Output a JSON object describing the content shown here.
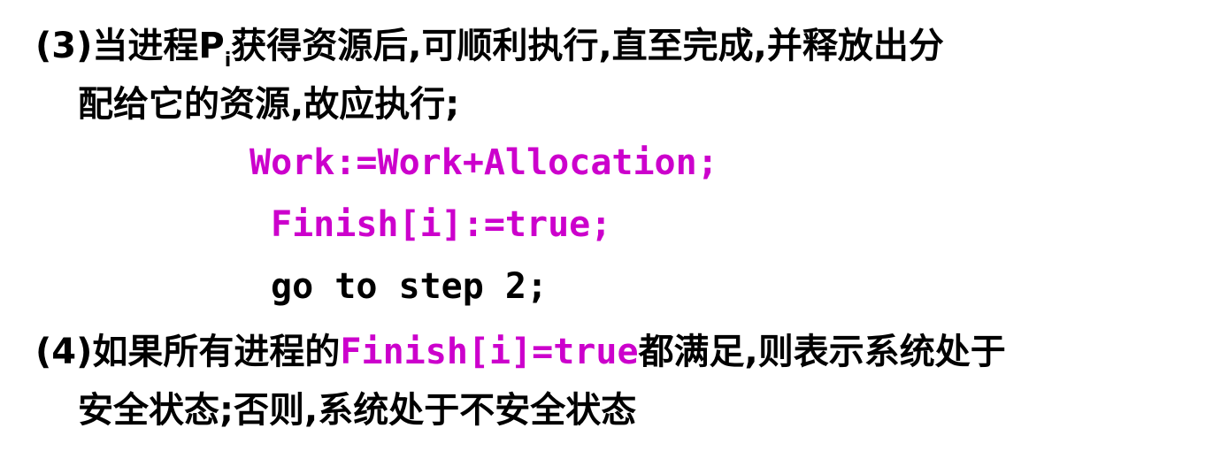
{
  "step3": {
    "prefix": "(3)当进程P",
    "subscript": "i",
    "suffix": "获得资源后,可顺利执行,直至完成,并释放出分",
    "line2": "配给它的资源,故应执行;"
  },
  "code": {
    "line1": "Work:=Work+Allocation;",
    "line2": "Finish[i]:=true;",
    "line3": "go to step 2;"
  },
  "step4": {
    "prefix": "(4)如果所有进程的",
    "highlight": "Finish[i]=true",
    "suffix": "都满足,则表示系统处于",
    "line2": "安全状态;否则,系统处于不安全状态"
  },
  "colors": {
    "text": "#000000",
    "highlight": "#cc00cc"
  }
}
